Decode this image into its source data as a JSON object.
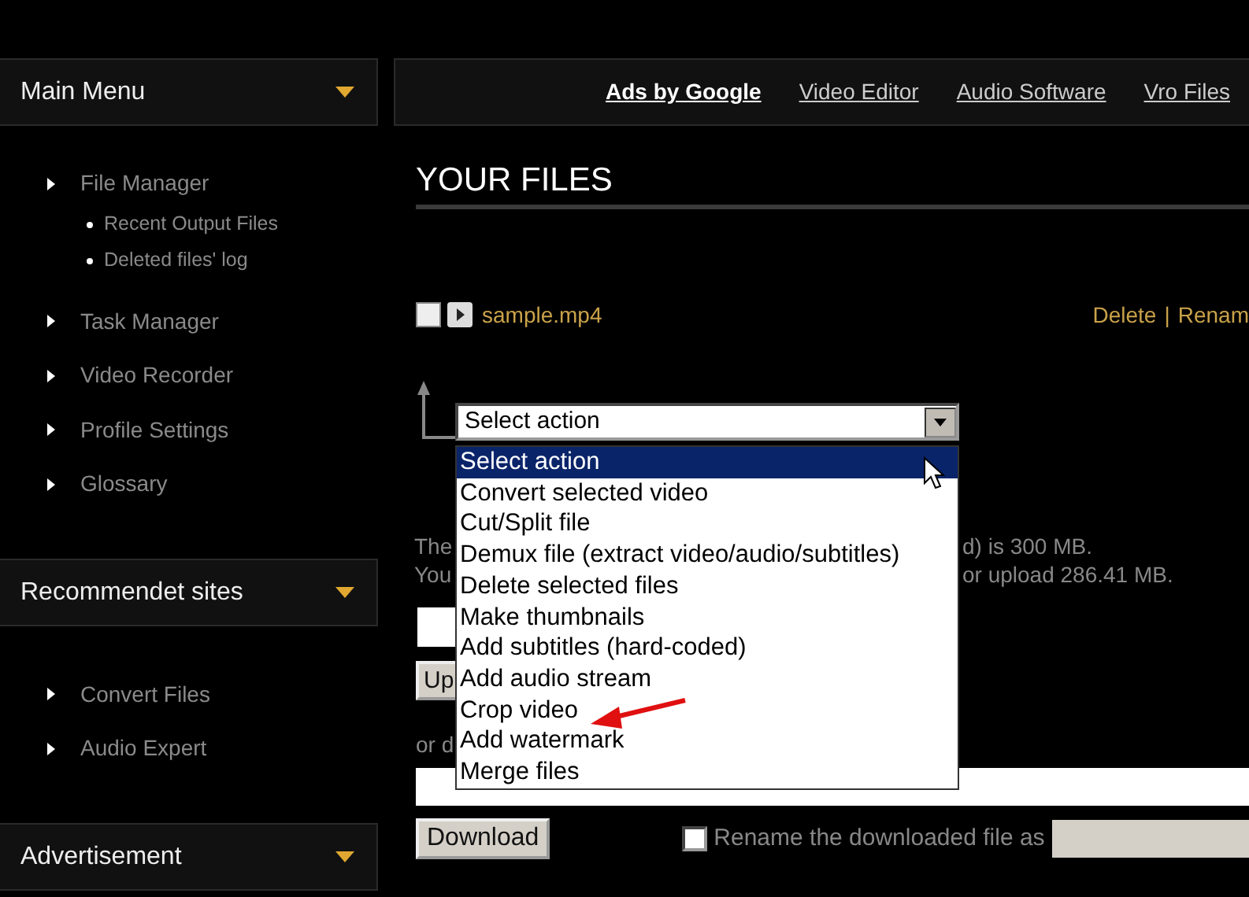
{
  "top_nav": {
    "links": [
      {
        "label": "Ads by Google",
        "kind": "heading"
      },
      {
        "label": "Video Editor",
        "kind": "link"
      },
      {
        "label": "Audio Software",
        "kind": "link"
      },
      {
        "label": "Vro Files",
        "kind": "link"
      }
    ]
  },
  "sidebar": {
    "panels": [
      {
        "title": "Main Menu",
        "expanded": true,
        "items": [
          {
            "label": "File Manager",
            "children": [
              {
                "label": "Recent Output Files"
              },
              {
                "label": "Deleted files' log"
              }
            ]
          },
          {
            "label": "Task Manager"
          },
          {
            "label": "Video Recorder"
          },
          {
            "label": "Profile Settings"
          },
          {
            "label": "Glossary"
          }
        ]
      },
      {
        "title": "Recommendet sites",
        "expanded": true,
        "items": [
          {
            "label": "Convert Files"
          },
          {
            "label": "Audio Expert"
          }
        ]
      },
      {
        "title": "Advertisement",
        "expanded": true
      }
    ]
  },
  "content": {
    "title": "YOUR FILES",
    "files": [
      {
        "name": "sample.mp4",
        "checked": false,
        "actions": [
          "Delete",
          "Renam"
        ],
        "separator": "|"
      }
    ],
    "action_select": {
      "value": "Select action",
      "expanded": true,
      "options": [
        {
          "label": "Select action",
          "selected": true
        },
        {
          "label": "Convert selected video",
          "selected": false
        },
        {
          "label": "Cut/Split file",
          "selected": false
        },
        {
          "label": "Demux file (extract video/audio/subtitles)",
          "selected": false
        },
        {
          "label": "Delete selected files",
          "selected": false
        },
        {
          "label": "Make thumbnails",
          "selected": false
        },
        {
          "label": "Add subtitles (hard-coded)",
          "selected": false
        },
        {
          "label": "Add audio stream",
          "selected": false
        },
        {
          "label": "Crop video",
          "selected": false
        },
        {
          "label": "Add watermark",
          "selected": false
        },
        {
          "label": "Merge files",
          "selected": false
        }
      ]
    },
    "info_lines": [
      [
        "The",
        "d) is 300 MB."
      ],
      [
        "You",
        "or upload 286.41 MB."
      ]
    ],
    "upload_button": "Up",
    "or_text": "or d",
    "download_button": "Download",
    "rename": {
      "checked": false,
      "label": "Rename the downloaded file as"
    }
  }
}
